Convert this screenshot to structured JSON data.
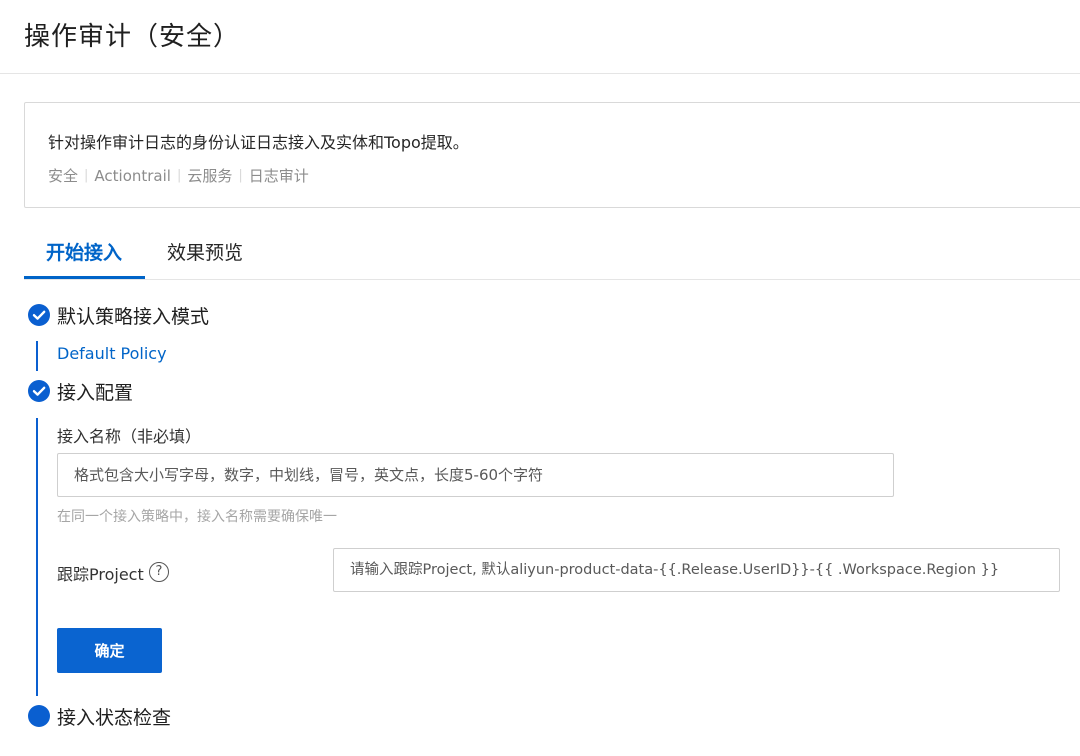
{
  "page": {
    "title": "操作审计（安全）"
  },
  "description_card": {
    "text": "针对操作审计日志的身份认证日志接入及实体和Topo提取。",
    "tags": [
      "安全",
      "Actiontrail",
      "云服务",
      "日志审计"
    ],
    "separator": "|"
  },
  "tabs": [
    {
      "label": "开始接入",
      "active": true
    },
    {
      "label": "效果预览",
      "active": false
    }
  ],
  "steps": [
    {
      "title": "默认策略接入模式",
      "status": "done",
      "icon": "check-circle-icon"
    },
    {
      "title": "接入配置",
      "status": "done",
      "icon": "check-circle-icon"
    },
    {
      "title": "接入状态检查",
      "status": "current",
      "icon": "filled-circle-icon"
    }
  ],
  "policy": {
    "link_label": "Default Policy"
  },
  "form": {
    "name_label": "接入名称（非必填）",
    "name_placeholder": "格式包含大小写字母，数字，中划线，冒号，英文点，长度5-60个字符",
    "name_hint": "在同一个接入策略中，接入名称需要确保唯一",
    "project_label": "跟踪Project",
    "help_glyph": "?",
    "project_placeholder": "请输入跟踪Project, 默认aliyun-product-data-{{.Release.UserID}}-{{ .Workspace.Region }}",
    "confirm_label": "确定"
  },
  "colors": {
    "accent": "#0064c8",
    "primary_button": "#0a64d0",
    "hint_text": "#a6a6a6",
    "tag_text": "#8c8c8c"
  }
}
